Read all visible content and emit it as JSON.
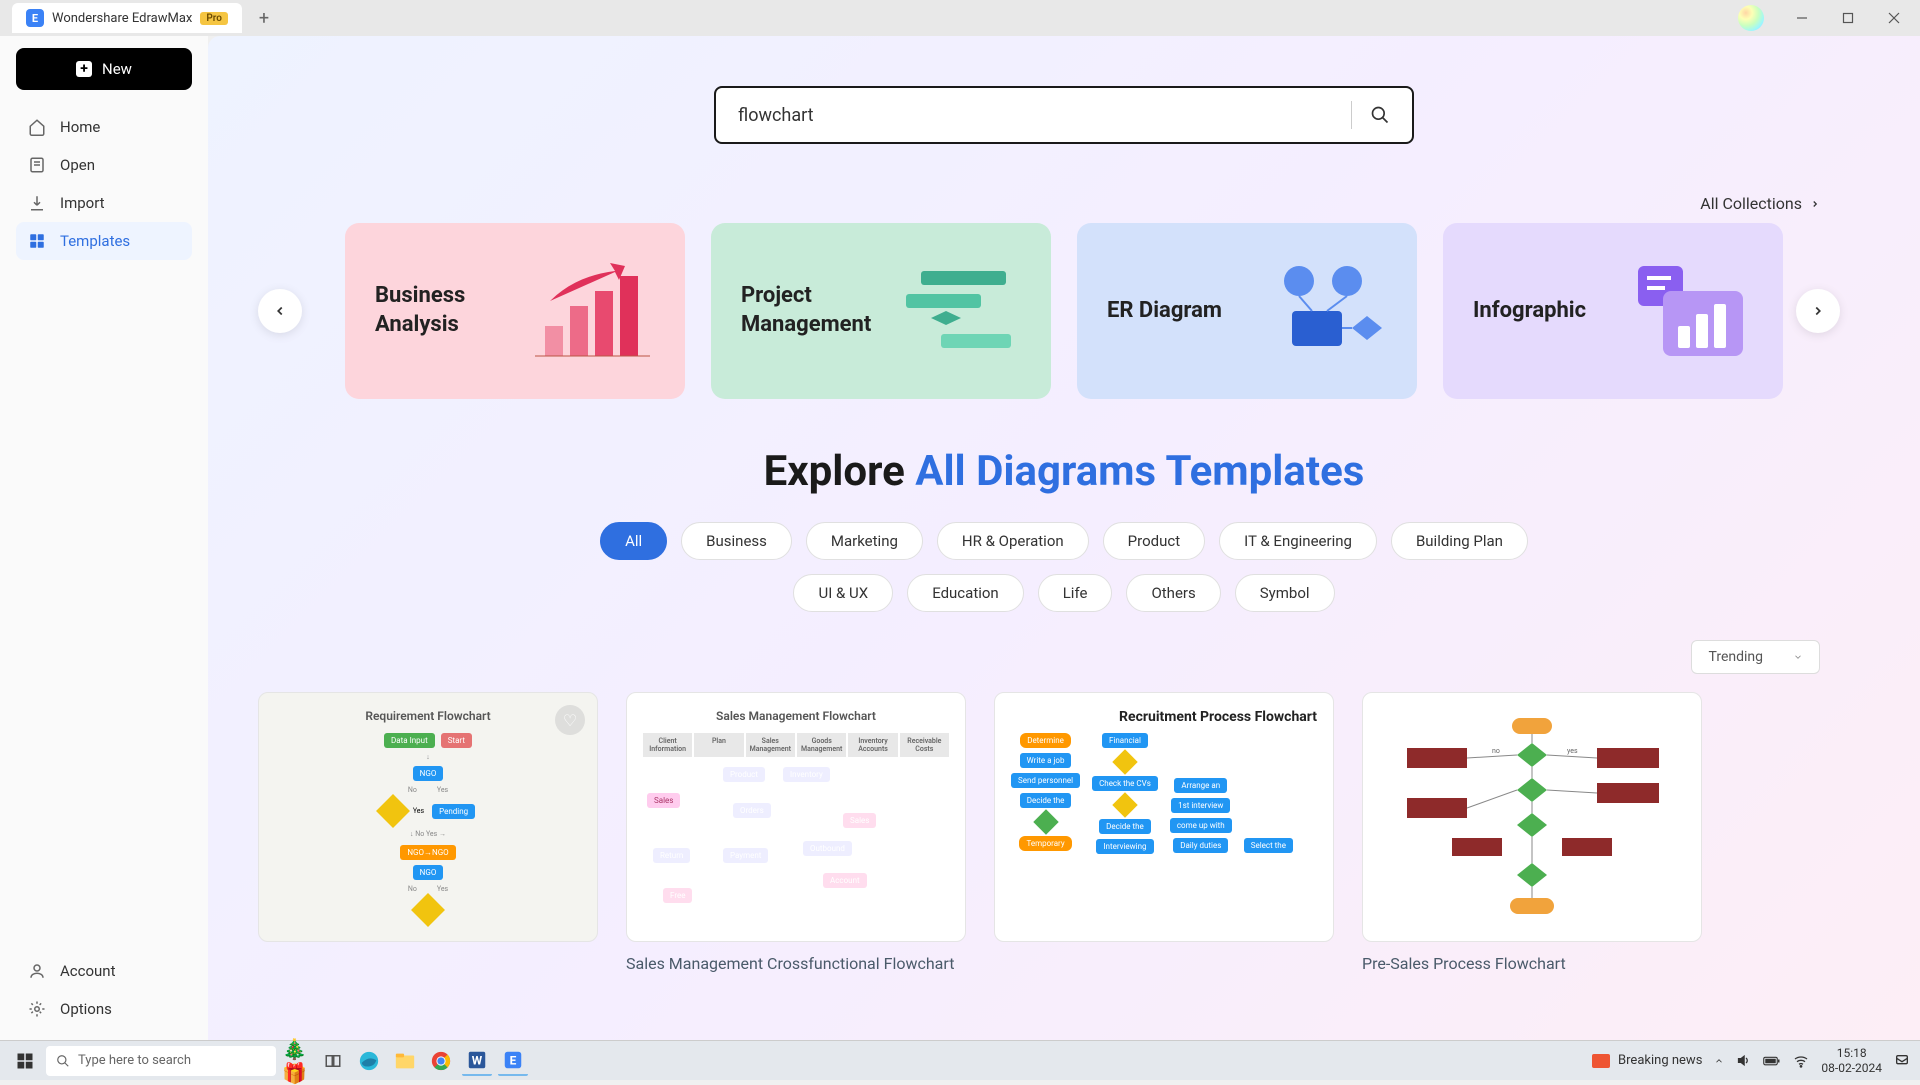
{
  "titlebar": {
    "app_name": "Wondershare EdrawMax",
    "badge": "Pro"
  },
  "sidebar": {
    "new_label": "New",
    "items": [
      {
        "label": "Home",
        "icon": "home-icon"
      },
      {
        "label": "Open",
        "icon": "file-icon"
      },
      {
        "label": "Import",
        "icon": "import-icon"
      },
      {
        "label": "Templates",
        "icon": "templates-icon"
      }
    ],
    "bottom": [
      {
        "label": "Account",
        "icon": "user-icon"
      },
      {
        "label": "Options",
        "icon": "gear-icon"
      }
    ]
  },
  "search": {
    "value": "flowchart"
  },
  "collections_link": "All Collections",
  "carousel": [
    {
      "title": "Business\nAnalysis",
      "color": "pink"
    },
    {
      "title": "Project\nManagement",
      "color": "green"
    },
    {
      "title": "ER Diagram",
      "color": "blue"
    },
    {
      "title": "Infographic",
      "color": "purple"
    }
  ],
  "explore": {
    "prefix": "Explore ",
    "highlight": "All Diagrams Templates"
  },
  "filters": {
    "row1": [
      "All",
      "Business",
      "Marketing",
      "HR & Operation",
      "Product",
      "IT & Engineering",
      "Building Plan"
    ],
    "row2": [
      "UI & UX",
      "Education",
      "Life",
      "Others",
      "Symbol"
    ],
    "active": "All"
  },
  "sort": {
    "selected": "Trending"
  },
  "templates": [
    {
      "title": "",
      "thumb_head": "Requirement Flowchart",
      "kind": "req"
    },
    {
      "title": "Sales Management Crossfunctional Flowchart",
      "thumb_head": "Sales Management Flowchart",
      "kind": "swim"
    },
    {
      "title": "",
      "thumb_head": "Recruitment Process Flowchart",
      "kind": "recruit"
    },
    {
      "title": "Pre-Sales Process Flowchart",
      "thumb_head": "",
      "kind": "presales"
    }
  ],
  "taskbar": {
    "search_placeholder": "Type here to search",
    "news": "Breaking news",
    "time": "15:18",
    "date": "08-02-2024"
  }
}
